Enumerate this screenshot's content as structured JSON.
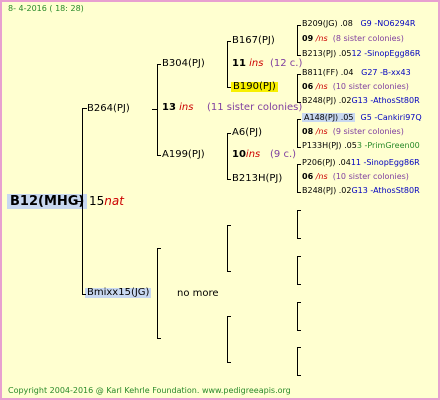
{
  "header": {
    "date": "8- 4-2016 ( 18: 28)"
  },
  "root": {
    "name": "B12(MHG)",
    "count": "15",
    "badge": "nat"
  },
  "gen1": {
    "top": {
      "name": "B264(PJ)",
      "count": "13",
      "badge": "ins",
      "colonies": "(11 sister colonies)"
    },
    "bottom": {
      "name": "Bmixx15(JG)",
      "more": "no more"
    }
  },
  "gen2": {
    "a": {
      "name": "B304(PJ)"
    },
    "b": {
      "name": "A199(PJ)",
      "count": "10",
      "badge": "ins",
      "colonies": "(9 c.)"
    }
  },
  "gen3": {
    "a": {
      "name": "B167(PJ)",
      "count": "11",
      "badge": "ins",
      "colonies": "(12 c.)"
    },
    "b": {
      "name": "B190(PJ)"
    },
    "c": {
      "name": "A6(PJ)"
    },
    "d": {
      "name": "B213H(PJ)"
    }
  },
  "gen4": {
    "r1": {
      "name": "B209(JG)",
      "num": ".08",
      "code": "G9 -NO6294R"
    },
    "r2": {
      "count": "09",
      "badge": "/ns",
      "colonies": "(8 sister colonies)"
    },
    "r3": {
      "name": "B213(PJ)",
      "num": ".05",
      "code": "12 -SinopEgg86R"
    },
    "r4": {
      "name": "B811(FF)",
      "num": ".04",
      "code": "G27 -B-xx43"
    },
    "r5": {
      "count": "06",
      "badge": "/ns",
      "colonies": "(10 sister colonies)"
    },
    "r6": {
      "name": "B248(PJ)",
      "num": ".02",
      "code": "G13 -AthosSt80R"
    },
    "r7": {
      "name": "A148(PJ)",
      "num": ".05",
      "code": "G5 -Cankiri97Q"
    },
    "r8": {
      "count": "08",
      "badge": "/ns",
      "colonies": "(9 sister colonies)"
    },
    "r9": {
      "name": "P133H(PJ)",
      "num": ".05",
      "code": "3 -PrimGreen00"
    },
    "r10": {
      "name": "P206(PJ)",
      "num": ".04",
      "code": "11 -SinopEgg86R"
    },
    "r11": {
      "count": "06",
      "badge": "/ns",
      "colonies": "(10 sister colonies)"
    },
    "r12": {
      "name": "B248(PJ)",
      "num": ".02",
      "code": "G13 -AthosSt80R"
    }
  },
  "footer": {
    "text": "Copyright 2004-2016 @ Karl Kehrle Foundation.  www.pedigreeapis.org"
  },
  "colors": {
    "background": "#ffffd0",
    "border": "#e8a0d0",
    "highlight": "#f8f000",
    "green": "#2a8a2a",
    "blue": "#0000c0",
    "red": "#cc0000"
  }
}
